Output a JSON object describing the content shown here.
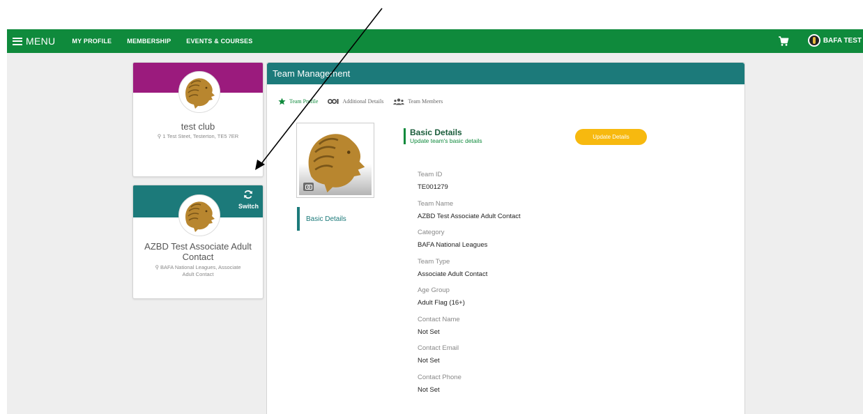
{
  "topbar": {
    "menu_label": "MENU",
    "nav_links": [
      "MY PROFILE",
      "MEMBERSHIP",
      "EVENTS & COURSES"
    ],
    "user_name": "BAFA TEST"
  },
  "club_card": {
    "name": "test club",
    "address": "1 Test Steet, Testerton, TE5 7ER"
  },
  "team_card": {
    "name": "AZBD Test Associate Adult Contact",
    "details": "BAFA National Leagues, Associate Adult Contact",
    "switch_label": "Switch"
  },
  "panel": {
    "title": "Team Management",
    "tabs": [
      {
        "label": "Team Profile",
        "icon": "star-icon"
      },
      {
        "label": "Additional Details",
        "icon": "gears-icon"
      },
      {
        "label": "Team Members",
        "icon": "users-icon"
      }
    ],
    "side_nav_label": "Basic Details",
    "section_title": "Basic Details",
    "section_subtitle": "Update team's basic details",
    "update_button": "Update Details",
    "fields": [
      {
        "label": "Team ID",
        "value": "TE001279"
      },
      {
        "label": "Team Name",
        "value": "AZBD Test Associate Adult Contact"
      },
      {
        "label": "Category",
        "value": "BAFA National Leagues"
      },
      {
        "label": "Team Type",
        "value": "Associate Adult Contact"
      },
      {
        "label": "Age Group",
        "value": "Adult Flag (16+)"
      },
      {
        "label": "Contact Name",
        "value": "Not Set"
      },
      {
        "label": "Contact Email",
        "value": "Not Set"
      },
      {
        "label": "Contact Phone",
        "value": "Not Set"
      }
    ]
  },
  "colors": {
    "nav_green": "#0f8a3c",
    "club_band": "#9b1b7d",
    "team_teal": "#1c7a7a",
    "button_yellow": "#f7b90f",
    "lion_gold": "#b8862f"
  }
}
